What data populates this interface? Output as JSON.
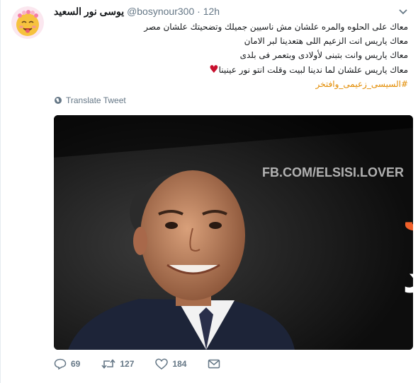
{
  "tweet": {
    "author_name": "يوسى نور السعيد",
    "handle": "@bosynour300",
    "separator": "·",
    "time": "12h",
    "lines": [
      "معاك على الحلوه والمره علشان مش ناسيين جميلك وتضحيتك علشان مصر",
      "معاك ياريس انت الزعيم اللى هتعدينا لبر الامان",
      "معاك ياريس وانت بتبنى لأولادى وبتعمر فى بلدى",
      "معاك ياريس علشان لما ندينا لبيت وقلت انتو نور عينينا"
    ],
    "heart_emoji": "♥",
    "hashtag": "#السيسى_زعيمى_وافتخر",
    "translate_label": "Translate Tweet"
  },
  "media": {
    "watermark": "FB.COM/ELSISI.LOVER",
    "headline": "ثقتى فيك",
    "subline": "بلا حدود",
    "headline_color": "#f0602a",
    "subline_color": "#ffffff"
  },
  "actions": {
    "replies": "69",
    "retweets": "127",
    "likes": "184",
    "icons": [
      "reply-icon",
      "retweet-icon",
      "like-icon",
      "message-icon"
    ]
  },
  "colors": {
    "hashtag": "#e28b00",
    "muted": "#657786",
    "heart": "#c8102e"
  }
}
